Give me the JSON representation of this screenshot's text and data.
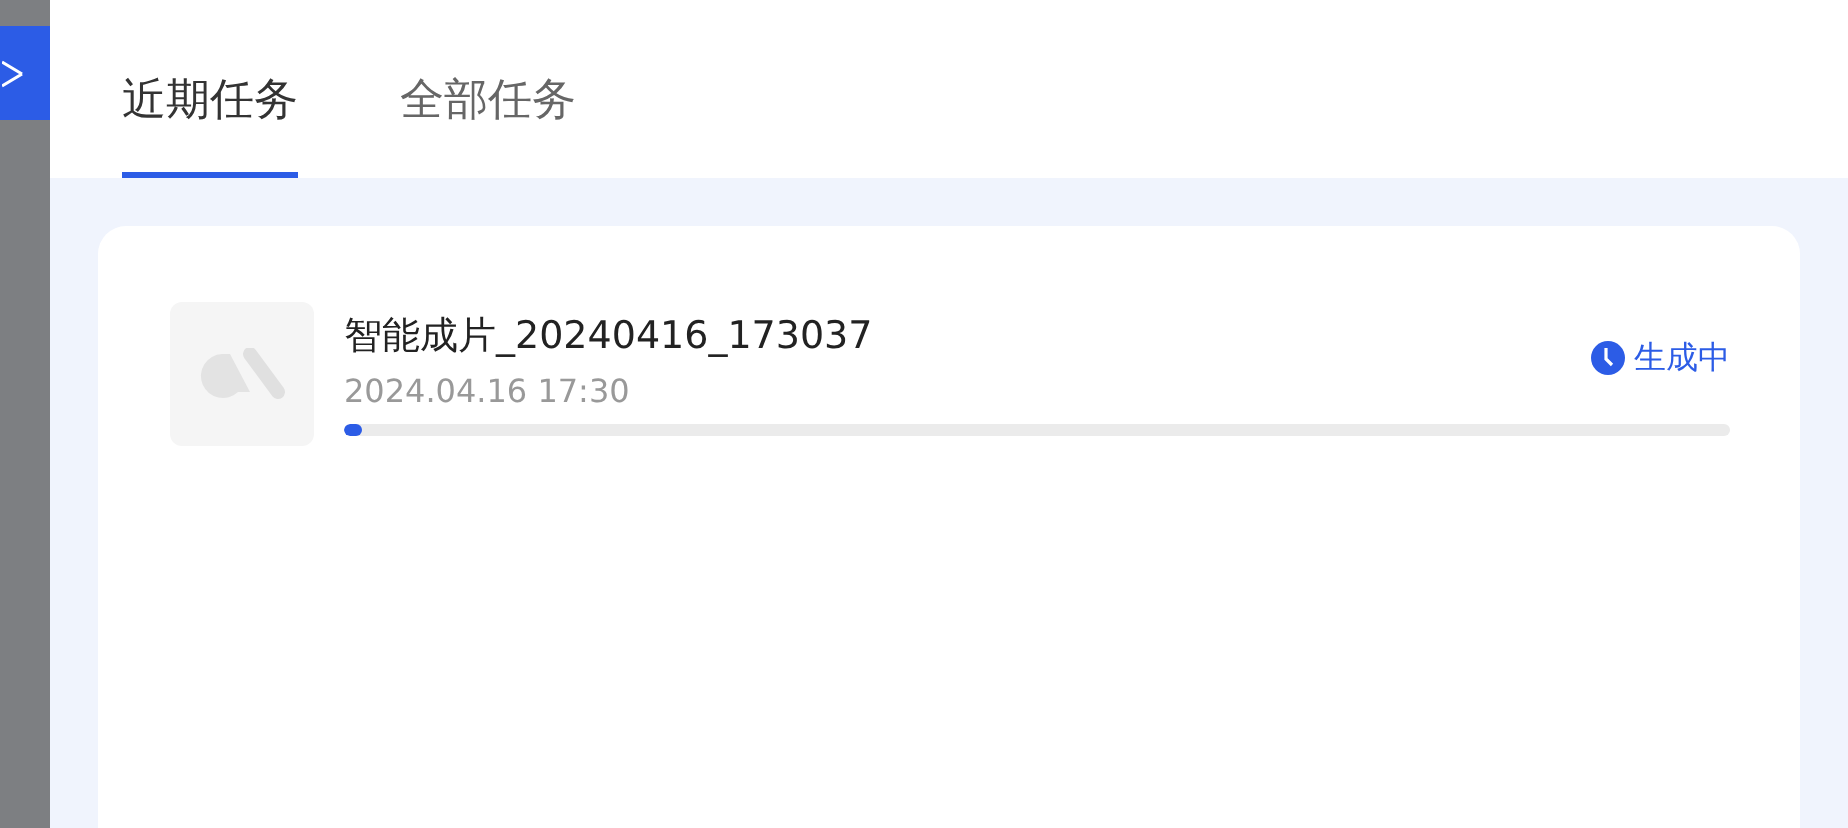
{
  "tabs": [
    {
      "label": "近期任务",
      "selected": true
    },
    {
      "label": "全部任务",
      "selected": false
    }
  ],
  "tasks": [
    {
      "title": "智能成片_20240416_173037",
      "time": "2024.04.16 17:30",
      "status": "生成中",
      "level": 0.013
    }
  ]
}
